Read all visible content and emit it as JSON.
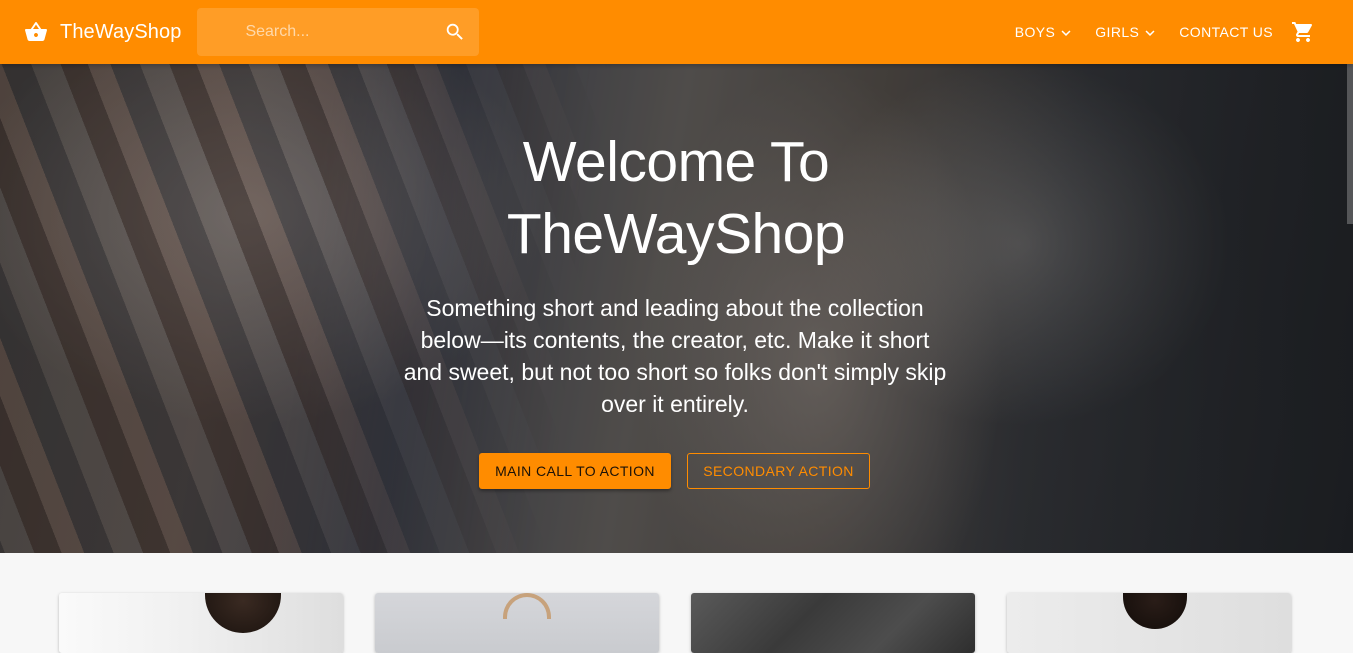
{
  "header": {
    "brand_name": "TheWayShop",
    "brand_icon": "shopping-basket-icon",
    "search_placeholder": "Search...",
    "search_icon": "search-icon",
    "nav": [
      {
        "label": "BOYS",
        "has_dropdown": true
      },
      {
        "label": "GIRLS",
        "has_dropdown": true
      },
      {
        "label": "CONTACT US",
        "has_dropdown": false
      }
    ],
    "cart_icon": "shopping-cart-icon"
  },
  "hero": {
    "title_line1": "Welcome To",
    "title_line2": "TheWayShop",
    "description": "Something short and leading about the collection below—its contents, the creator, etc. Make it short and sweet, but not too short so folks don't simply skip over it entirely.",
    "primary_button": "MAIN CALL TO ACTION",
    "secondary_button": "SECONDARY ACTION"
  },
  "colors": {
    "accent": "#ff8c00",
    "text_on_accent": "#ffffff",
    "page_background": "#f7f7f7"
  }
}
